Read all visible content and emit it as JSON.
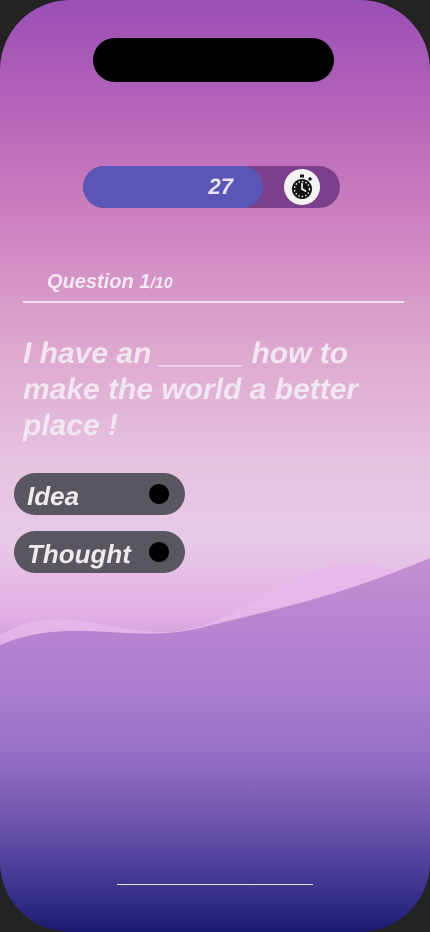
{
  "timer": {
    "value": "27",
    "remaining_fraction": 0.7,
    "icon": "stopwatch-icon"
  },
  "question": {
    "label": "Question 1",
    "total": "/10",
    "text": "I have an _____ how to make the world a better place !"
  },
  "options": [
    {
      "label": "Idea"
    },
    {
      "label": "Thought"
    }
  ],
  "colors": {
    "timer_track": "#7b3f8c",
    "timer_fill": "#5b55b6",
    "option_bg": "#5a5660",
    "radio": "#000000"
  }
}
